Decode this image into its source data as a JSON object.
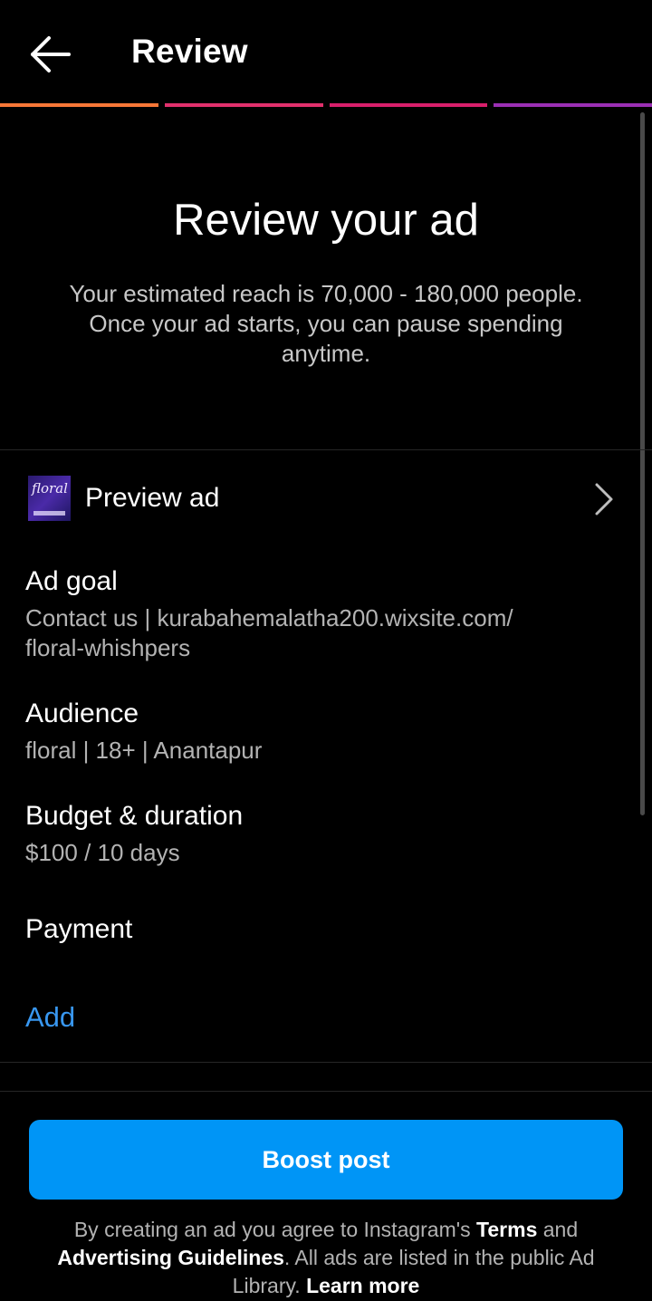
{
  "header": {
    "title": "Review"
  },
  "progress": {
    "segments": [
      "#f77737",
      "#e1306c",
      "#d81f6b",
      "#9b2fb4"
    ]
  },
  "hero": {
    "title": "Review your ad",
    "subtitle": "Your estimated reach is 70,000 - 180,000 people. Once your ad starts, you can pause spending anytime."
  },
  "preview": {
    "label": "Preview ad",
    "thumb_text": "floral"
  },
  "sections": {
    "ad_goal": {
      "title": "Ad goal",
      "value_line1": "Contact us | kurabahemalatha200.wixsite.com/",
      "value_line2": "floral-whishpers"
    },
    "audience": {
      "title": "Audience",
      "value": "floral | 18+ | Anantapur"
    },
    "budget": {
      "title": "Budget & duration",
      "value": "$100 / 10 days"
    },
    "payment": {
      "title": "Payment",
      "add_label": "Add"
    }
  },
  "footer": {
    "boost_label": "Boost post",
    "legal_part1": "By creating an ad you agree to Instagram's ",
    "terms_link": "Terms",
    "legal_part2": " and ",
    "guidelines_link": "Advertising Guidelines",
    "legal_part3": ". All ads are listed in the public Ad Library. ",
    "learn_more_link": "Learn more"
  },
  "colors": {
    "accent": "#0095f6",
    "link": "#3897f0",
    "background": "#000000"
  }
}
